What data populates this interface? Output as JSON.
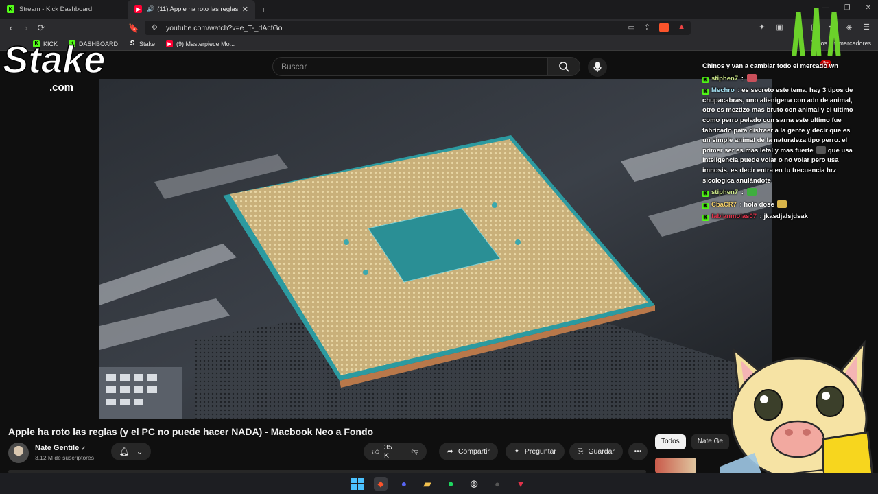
{
  "tabs": [
    {
      "title": "Stream - Kick Dashboard",
      "active": false
    },
    {
      "title": "(11) Apple ha roto las reglas (",
      "active": true
    }
  ],
  "address_bar": {
    "url": "youtube.com/watch?v=e_T-_dAcfGo"
  },
  "bookmarks": [
    {
      "label": "KICK"
    },
    {
      "label": "DASHBOARD"
    },
    {
      "label": "Stake"
    },
    {
      "label": "(9) Masterpiece Mo..."
    }
  ],
  "bookmarks_right": "Todos los marcadores",
  "notification_badge": "9+",
  "youtube": {
    "search_placeholder": "Buscar",
    "video_title": "Apple ha roto las reglas (y el PC no puede hacer NADA) - Macbook Neo a Fondo",
    "channel_name": "Nate Gentile",
    "subscribers": "3,12 M de suscriptores",
    "likes": "35 K",
    "share_label": "Compartir",
    "ask_label": "Preguntar",
    "save_label": "Guardar",
    "chips": [
      "Todos",
      "Nate Ge"
    ]
  },
  "overlays": {
    "stake_logo": "Stake",
    "stake_domain": ".com"
  },
  "chat": [
    {
      "user": "",
      "text": "Chinos y van a cambiar todo el mercado wn",
      "color": "#ffffff"
    },
    {
      "user": "stiphen7",
      "text": ":",
      "color": "#cde88a"
    },
    {
      "user": "Mechro",
      "text": ": es secreto este tema, hay 3 tipos de chupacabras, uno alienigena con adn de animal, otro es meztizo mas bruto con animal y el ultimo como perro pelado con sarna este ultimo fue fabricado para distraer a la gente y decir que es un simple animal de la naturaleza tipo perro. el primer ser es mas letal y mas fuerte",
      "text2": "que usa inteligencia puede volar o no volar pero usa imnosis, es decir entra en tu frecuencia hrz sicologica anulándote",
      "color": "#a6e3f5"
    },
    {
      "user": "stiphen7",
      "text": ":",
      "color": "#cde88a"
    },
    {
      "user": "CbaCR7",
      "text": ": hola dose",
      "color": "#f7d26b"
    },
    {
      "user": "fabianmolas07",
      "text": ": jkasdjalsjdsak",
      "color": "#e0324a"
    }
  ],
  "taskbar_apps": [
    "windows-start",
    "brave",
    "discord",
    "file-explorer",
    "spotify",
    "obs",
    "app-dark",
    "app-red"
  ]
}
